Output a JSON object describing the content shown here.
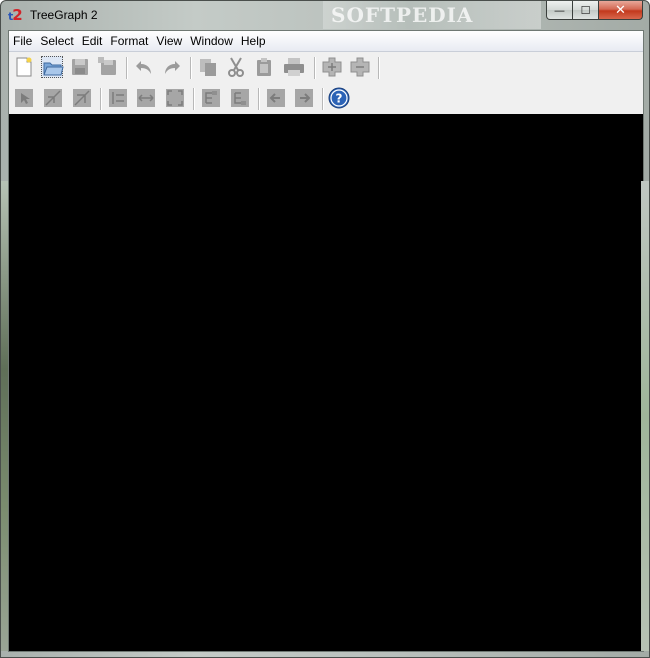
{
  "window": {
    "title": "TreeGraph 2",
    "icon_text": "t2",
    "watermark": "SOFTPEDIA",
    "controls": {
      "minimize": "—",
      "maximize": "☐",
      "close": "✕"
    }
  },
  "menu": [
    "File",
    "Select",
    "Edit",
    "Format",
    "View",
    "Window",
    "Help"
  ],
  "toolbar_row1": [
    "new-document-icon",
    "open-folder-icon",
    "save-icon",
    "save-as-icon",
    "undo-icon",
    "redo-icon",
    "copy-icon",
    "cut-icon",
    "paste-icon",
    "print-icon",
    "expand-node-icon",
    "collapse-node-icon"
  ],
  "toolbar_row2": [
    "select-node-icon",
    "select-branch-icon",
    "select-subtree-icon",
    "align-icon",
    "stretch-horizontal-icon",
    "fit-to-window-icon",
    "move-subtree-up-icon",
    "move-subtree-down-icon",
    "arrow-left-icon",
    "arrow-right-icon",
    "help-icon"
  ],
  "colors": {
    "canvas": "#000000",
    "icon_disabled": "#9b9b9b",
    "help_blue": "#2b62b6",
    "app_icon_red": "#d2242a"
  }
}
